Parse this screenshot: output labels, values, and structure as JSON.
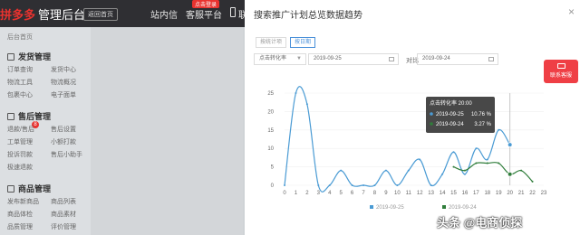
{
  "topbar": {
    "logo_text": "拼多多",
    "title": "管理后台",
    "back_label": "返回首页",
    "nav": [
      "站内信",
      "客服平台",
      "联"
    ],
    "nav_badge": "点击登录"
  },
  "sidebar": {
    "breadcrumb": "后台首页",
    "sections": [
      {
        "title": "发货管理",
        "items": [
          "订单查询",
          "发货中心",
          "物流工具",
          "物流概况",
          "包裹中心",
          "电子面单"
        ]
      },
      {
        "title": "售后管理",
        "items": [
          "退款/售后",
          "售后设置",
          "工单管理",
          "小额打款",
          "投诉罚款",
          "售后小助手",
          "极速退款"
        ]
      },
      {
        "title": "商品管理",
        "items": [
          "发布新商品",
          "商品列表",
          "商品体检",
          "商品素材",
          "品质管理",
          "评价管理"
        ]
      }
    ],
    "aftersale_badge": "8"
  },
  "modal": {
    "title": "搜索推广计划总览数据趋势",
    "tabs": [
      "按统计项",
      "按日期"
    ],
    "metric_select": "点击转化率",
    "date_a": "2019-09-25",
    "compare_label": "对比",
    "date_b": "2019-09-24"
  },
  "tooltip": {
    "title": "点击转化率 20:00",
    "rows": [
      {
        "date": "2019-09-25",
        "value": "10.76 %"
      },
      {
        "date": "2019-09-24",
        "value": "3.27 %"
      }
    ]
  },
  "contact": {
    "label": "联系客服"
  },
  "watermark": "头条 @电商侦探",
  "chart_data": {
    "type": "line",
    "x": [
      0,
      1,
      2,
      3,
      4,
      5,
      6,
      7,
      8,
      9,
      10,
      11,
      12,
      13,
      14,
      15,
      16,
      17,
      18,
      19,
      20,
      21,
      22,
      23
    ],
    "x_ticks": [
      "0",
      "1",
      "2",
      "3",
      "4",
      "5",
      "6",
      "7",
      "8",
      "9",
      "10",
      "11",
      "12",
      "13",
      "14",
      "15",
      "16",
      "17",
      "18",
      "19",
      "20",
      "21",
      "22",
      "23"
    ],
    "y_ticks": [
      "0",
      "5",
      "10",
      "15",
      "20",
      "25"
    ],
    "ylim": [
      0,
      25
    ],
    "hover_x": 20,
    "series": [
      {
        "name": "2019-09-25",
        "color": "#4a9bd4",
        "values": [
          0,
          25,
          22,
          0,
          0,
          4,
          0,
          0,
          0,
          4,
          0,
          4,
          7,
          0,
          3,
          9,
          3,
          10,
          7,
          15,
          11,
          null,
          null,
          null
        ]
      },
      {
        "name": "2019-09-24",
        "color": "#2f7d3a",
        "values": [
          null,
          null,
          null,
          null,
          null,
          null,
          null,
          null,
          null,
          null,
          null,
          null,
          null,
          null,
          null,
          5,
          4,
          6,
          6,
          6,
          3,
          4,
          1,
          null
        ]
      }
    ]
  },
  "colors": {
    "accent": "#4a90d9",
    "brand": "#e8322f",
    "primary_line": "#4a9bd4",
    "secondary_line": "#2f7d3a"
  }
}
